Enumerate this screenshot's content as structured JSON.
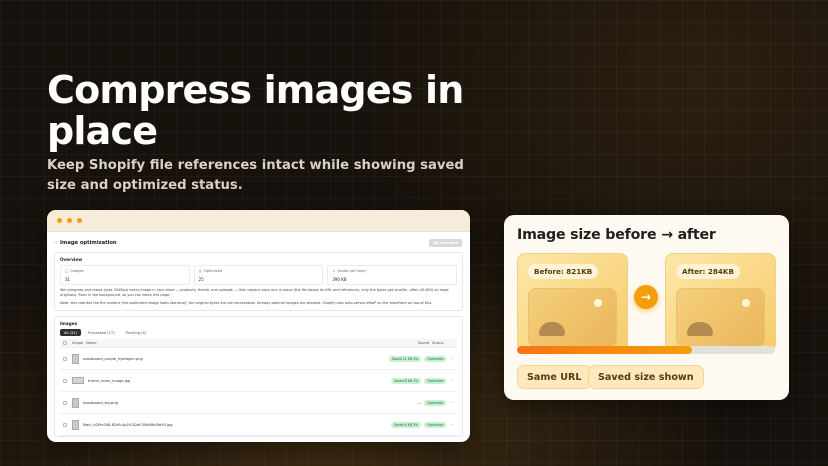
{
  "hero": {
    "title": "Compress images in place",
    "subtitle": "Keep Shopify file references intact while showing saved size and optimized status."
  },
  "app": {
    "back": "‹",
    "page_title": "Image optimization",
    "action": "All unlocked",
    "overview": {
      "heading": "Overview",
      "stats": [
        {
          "label": "Images",
          "value": "31"
        },
        {
          "label": "Optimized",
          "value": "25"
        },
        {
          "label": "Saved (all time)",
          "value": "390 KB"
        }
      ],
      "note1": "We compress and resize (max 2048px) every image in your store — products, theme, and uploads — then replace each one in place (the file keeps its URL and references, only the bytes get smaller, often 40-80% on large originals). Runs in the background, so you can leave this page.",
      "note2": "Note: this rewrites the file content (the optimized image looks identical); the original bytes are not recoverable. Already-optimal images are skipped. Shopify also auto-serves WebP on the storefront on top of this."
    },
    "images": {
      "heading": "Images",
      "tabs": [
        "All (31)",
        "Processed (27)",
        "Pending (4)"
      ],
      "columns": {
        "image": "Image",
        "name": "Name",
        "saved": "Saved",
        "status": "Status"
      },
      "rows": [
        {
          "name": "snowboard_purple_hydrogen.png",
          "saved": "Saved 12 KB",
          "pct": "4%",
          "status": "Optimized",
          "wide": false
        },
        {
          "name": "frame_cover_image.jpg",
          "saved": "Saved 8 KB",
          "pct": "3%",
          "status": "Optimized",
          "wide": true
        },
        {
          "name": "snowboard_sky.png",
          "saved": "—",
          "pct": "",
          "status": "Optimized",
          "wide": false
        },
        {
          "name": "Main_b2f9c008-82d9-4a20-82af-50df6fb3fe50.jpg",
          "saved": "Saved 6 KB",
          "pct": "3%",
          "status": "Optimized",
          "wide": false
        }
      ]
    }
  },
  "compare": {
    "title": "Image size before → after",
    "before_label": "Before: 821KB",
    "after_label": "After: 284KB",
    "progress": 0.68,
    "chips": [
      "Same URL",
      "Saved size shown"
    ]
  },
  "colors": {
    "accent": "#f59e0b",
    "bar_start": "#f97316",
    "success_bg": "#c9f0d4"
  }
}
